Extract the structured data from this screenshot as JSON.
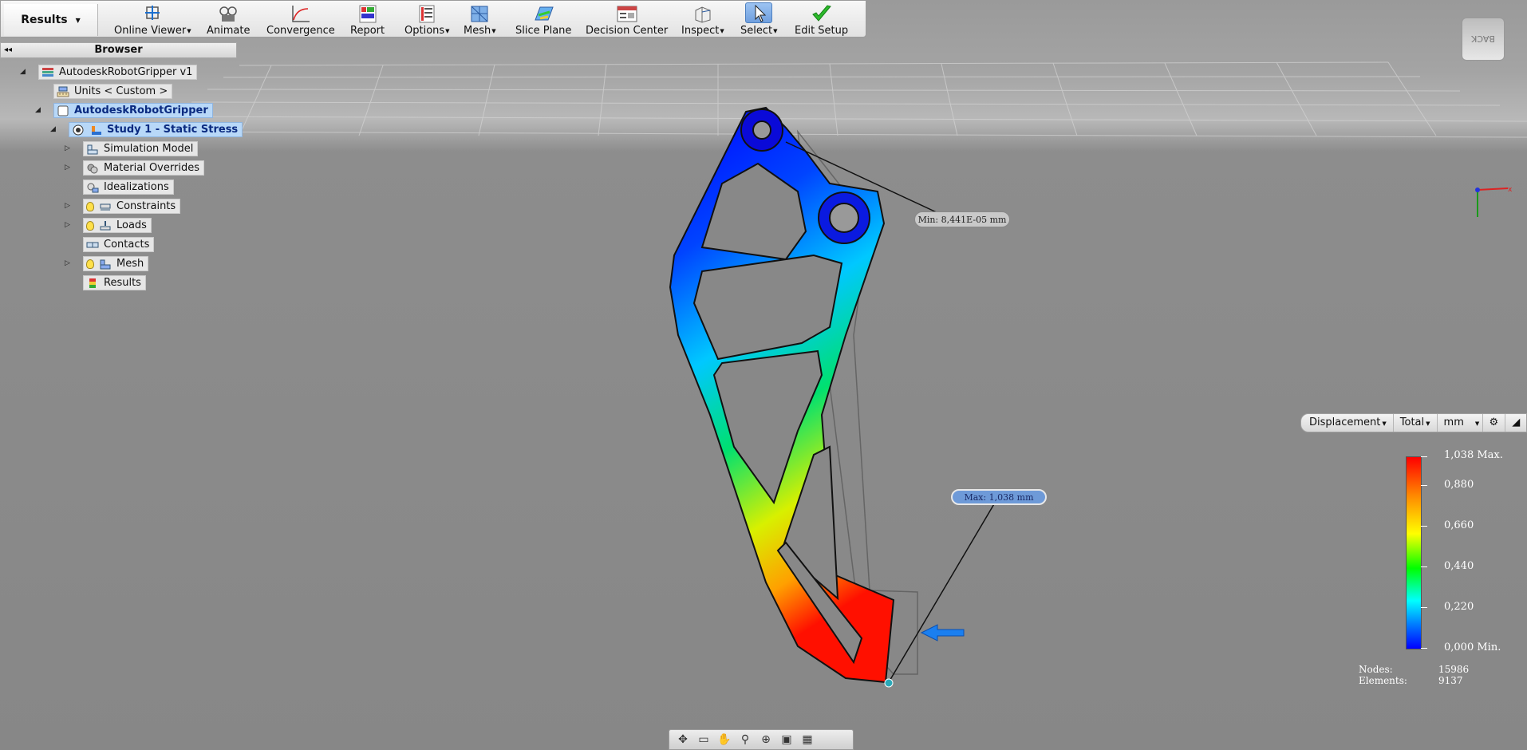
{
  "ribbon": {
    "active_tab": "Results",
    "tools": [
      {
        "label": "Online Viewer",
        "dropdown": true,
        "icon": "online-viewer-icon"
      },
      {
        "label": "Animate",
        "dropdown": false,
        "icon": "animate-icon"
      },
      {
        "label": "Convergence",
        "dropdown": false,
        "icon": "convergence-icon"
      },
      {
        "label": "Report",
        "dropdown": false,
        "icon": "report-icon"
      },
      {
        "label": "Options",
        "dropdown": true,
        "icon": "options-icon"
      },
      {
        "label": "Mesh",
        "dropdown": true,
        "icon": "mesh-icon"
      },
      {
        "label": "Slice Plane",
        "dropdown": false,
        "icon": "slice-plane-icon"
      },
      {
        "label": "Decision Center",
        "dropdown": false,
        "icon": "decision-center-icon"
      },
      {
        "label": "Inspect",
        "dropdown": true,
        "icon": "inspect-icon"
      },
      {
        "label": "Select",
        "dropdown": true,
        "icon": "select-cursor-icon"
      },
      {
        "label": "Edit Setup",
        "dropdown": false,
        "icon": "checkmark-icon"
      }
    ]
  },
  "browser": {
    "title": "Browser",
    "tree": [
      {
        "label": "AutodeskRobotGripper v1",
        "icon": "assembly-icon"
      },
      {
        "label": "Units < Custom >",
        "icon": "units-icon"
      },
      {
        "label": "AutodeskRobotGripper",
        "icon": "component-icon",
        "selected": true
      },
      {
        "label": "Study 1 - Static Stress",
        "icon": "study-icon",
        "selected": true
      },
      {
        "label": "Simulation Model",
        "icon": "simulation-model-icon"
      },
      {
        "label": "Material Overrides",
        "icon": "material-icon"
      },
      {
        "label": "Idealizations",
        "icon": "idealizations-icon"
      },
      {
        "label": "Constraints",
        "icon": "constraints-icon"
      },
      {
        "label": "Loads",
        "icon": "loads-icon"
      },
      {
        "label": "Contacts",
        "icon": "contacts-icon"
      },
      {
        "label": "Mesh",
        "icon": "mesh-icon"
      },
      {
        "label": "Results",
        "icon": "results-icon"
      }
    ]
  },
  "viewcube_label": "BACK",
  "probes": {
    "min": "Min: 8,441E-05 mm",
    "max": "Max: 1,038 mm"
  },
  "legend": {
    "result_type": "Displacement",
    "component": "Total",
    "unit": "mm",
    "labels": [
      "1,038 Max.",
      "0,880",
      "0,660",
      "0,440",
      "0,220",
      "0,000 Min."
    ],
    "nodes_label": "Nodes:",
    "nodes_value": "15986",
    "elements_label": "Elements:",
    "elements_value": "9137",
    "colors": {
      "max": "#ff0000",
      "mid": "#00ff00",
      "min": "#0000ff"
    }
  }
}
